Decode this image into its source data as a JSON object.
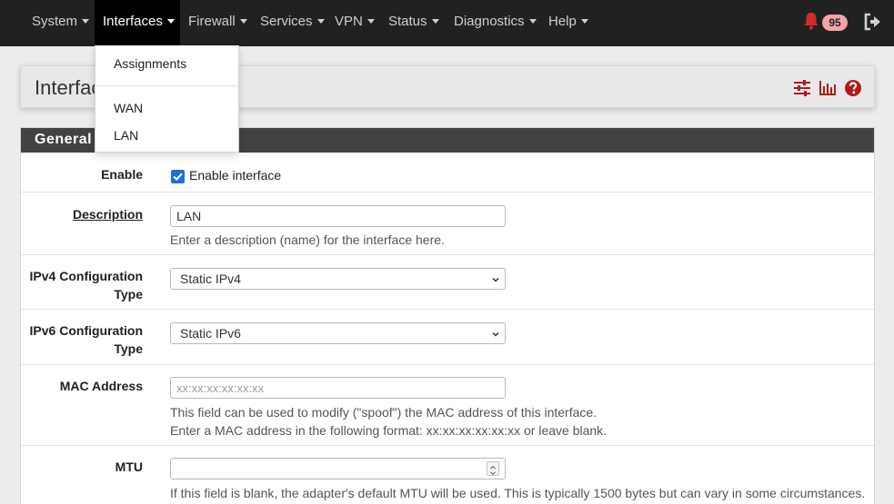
{
  "navbar": {
    "items": [
      {
        "label": "System"
      },
      {
        "label": "Interfaces"
      },
      {
        "label": "Firewall"
      },
      {
        "label": "Services"
      },
      {
        "label": "VPN"
      },
      {
        "label": "Status"
      },
      {
        "label": "Diagnostics"
      },
      {
        "label": "Help"
      }
    ],
    "notification_count": "95"
  },
  "dropdown": {
    "items": [
      {
        "label": "Assignments"
      },
      {
        "label": "WAN"
      },
      {
        "label": "LAN"
      }
    ]
  },
  "header": {
    "title": "Interfac"
  },
  "panel": {
    "title": "General"
  },
  "form": {
    "enable": {
      "label": "Enable",
      "checkbox_label": "Enable interface",
      "checked": true
    },
    "description": {
      "label": "Description",
      "value": "LAN",
      "help": "Enter a description (name) for the interface here."
    },
    "ipv4": {
      "label_line1": "IPv4 Configuration",
      "label_line2": "Type",
      "value": "Static IPv4"
    },
    "ipv6": {
      "label_line1": "IPv6 Configuration",
      "label_line2": "Type",
      "value": "Static IPv6"
    },
    "mac": {
      "label": "MAC Address",
      "placeholder": "xx:xx:xx:xx:xx:xx",
      "help_line1": "This field can be used to modify (\"spoof\") the MAC address of this interface.",
      "help_line2": "Enter a MAC address in the following format: xx:xx:xx:xx:xx:xx or leave blank."
    },
    "mtu": {
      "label": "MTU",
      "value": "",
      "help": "If this field is blank, the adapter's default MTU will be used. This is typically 1500 bytes but can vary in some circumstances."
    }
  },
  "colors": {
    "navbar_bg": "#212121",
    "accent_red": "#c8102e",
    "panel_heading": "#424242",
    "checkbox_blue": "#1e6fd8"
  }
}
